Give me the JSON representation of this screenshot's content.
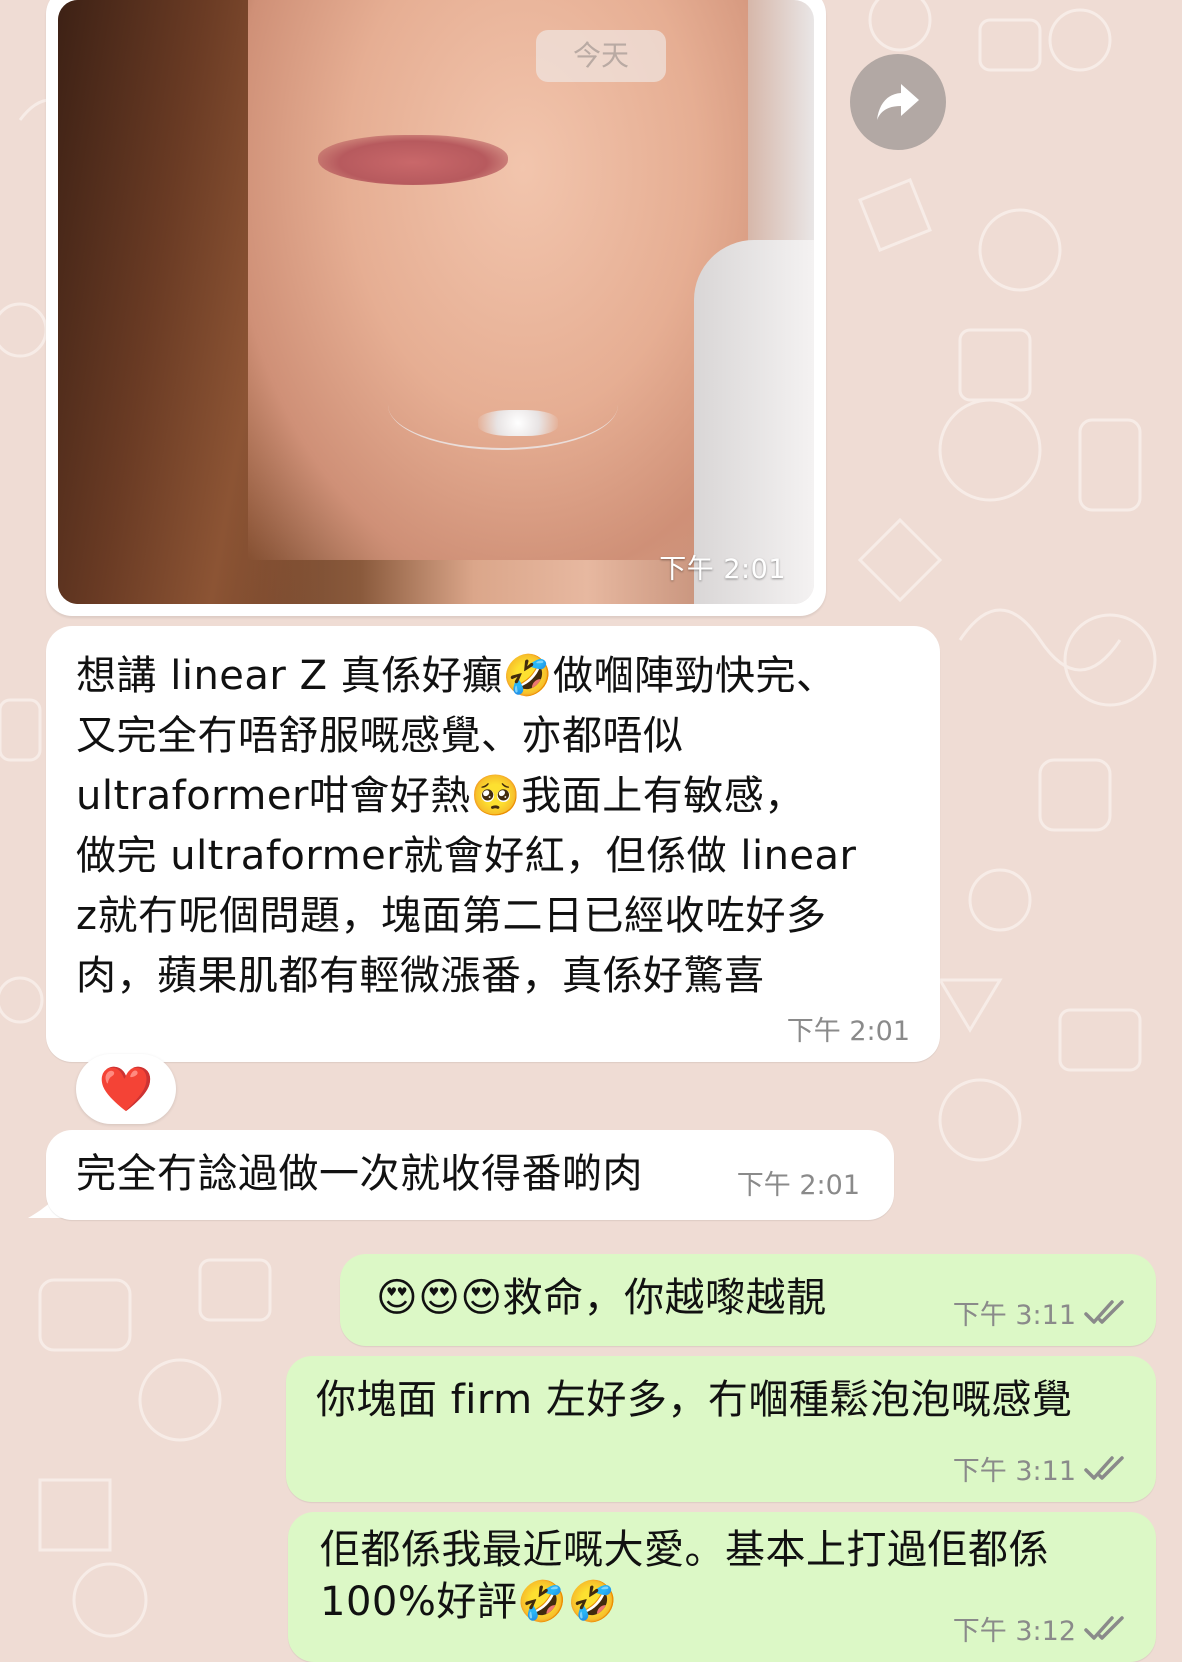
{
  "date_chip": "今天",
  "photo_message": {
    "time": "下午 2:01"
  },
  "messages": [
    {
      "direction": "incoming",
      "text": "想講 linear Z 真係好癲🤣做嗰陣勁快完、\n又完全冇唔舒服嘅感覺、亦都唔似\nultraformer咁會好熱🥺我面上有敏感，\n做完 ultraformer就會好紅，但係做 linear\nz就冇呢個問題，塊面第二日已經收咗好多\n肉，蘋果肌都有輕微漲番，真係好驚喜",
      "time": "下午 2:01",
      "reaction": "❤️"
    },
    {
      "direction": "incoming",
      "text": "完全冇諗過做一次就收得番啲肉",
      "time": "下午 2:01"
    },
    {
      "direction": "outgoing",
      "text": "😍😍😍救命，你越嚟越靚",
      "time": "下午 3:11",
      "status": "read"
    },
    {
      "direction": "outgoing",
      "text": "你塊面 firm 左好多，冇嗰種鬆泡泡嘅感覺",
      "time": "下午 3:11",
      "status": "read"
    },
    {
      "direction": "outgoing",
      "text": "佢都係我最近嘅大愛。基本上打過佢都係\n100%好評🤣🤣",
      "time": "下午 3:12",
      "status": "read"
    }
  ],
  "icons": {
    "forward": "forward-icon",
    "read_receipt": "double-check-icon"
  },
  "colors": {
    "wallpaper": "#efdcd4",
    "incoming_bubble": "#ffffff",
    "outgoing_bubble": "#dcf8c6",
    "read_check": "#8a8a8a"
  }
}
